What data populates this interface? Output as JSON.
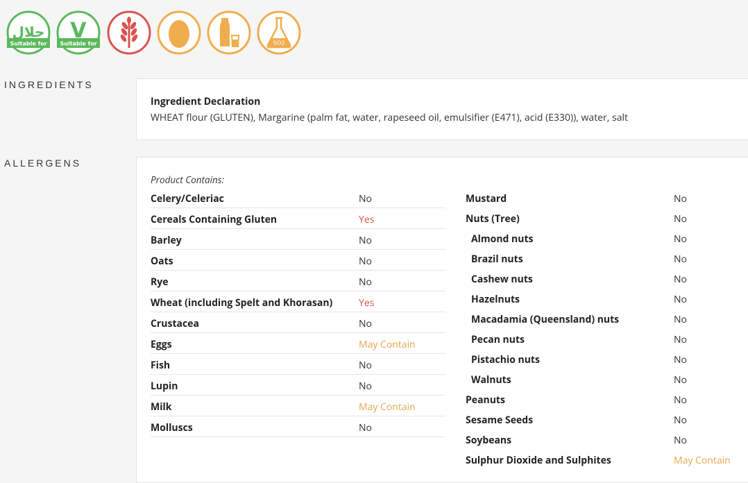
{
  "icons": [
    {
      "name": "halal-icon",
      "text": "حلال",
      "badge": "Suitable for",
      "color": "#5cb85c"
    },
    {
      "name": "vegetarian-icon",
      "text": "V",
      "badge": "Suitable for",
      "color": "#5cb85c"
    },
    {
      "name": "wheat-gluten-icon",
      "color": "#d9534f"
    },
    {
      "name": "egg-icon",
      "color": "#f0ad4e"
    },
    {
      "name": "milk-icon",
      "color": "#f0ad4e"
    },
    {
      "name": "sulphites-icon",
      "text": "SO2",
      "color": "#f0ad4e"
    }
  ],
  "sections": {
    "ingredients_label": "INGREDIENTS",
    "allergens_label": "ALLERGENS"
  },
  "ingredients": {
    "title": "Ingredient Declaration",
    "text": "WHEAT flour (GLUTEN), Margarine (palm fat, water, rapeseed oil, emulsifier (E471), acid (E330)), water, salt"
  },
  "allergens": {
    "contains_label": "Product Contains:",
    "left": [
      {
        "name": "Celery/Celeriac",
        "value": "No",
        "status": "no"
      },
      {
        "name": "Cereals Containing Gluten",
        "value": "Yes",
        "status": "yes"
      },
      {
        "name": "Barley",
        "value": "No",
        "status": "no"
      },
      {
        "name": "Oats",
        "value": "No",
        "status": "no"
      },
      {
        "name": "Rye",
        "value": "No",
        "status": "no"
      },
      {
        "name": "Wheat (including Spelt and Khorasan)",
        "value": "Yes",
        "status": "yes"
      },
      {
        "name": "Crustacea",
        "value": "No",
        "status": "no"
      },
      {
        "name": "Eggs",
        "value": "May Contain",
        "status": "may"
      },
      {
        "name": "Fish",
        "value": "No",
        "status": "no"
      },
      {
        "name": "Lupin",
        "value": "No",
        "status": "no"
      },
      {
        "name": "Milk",
        "value": "May Contain",
        "status": "may"
      },
      {
        "name": "Molluscs",
        "value": "No",
        "status": "no"
      }
    ],
    "right": [
      {
        "name": "Mustard",
        "value": "No",
        "status": "no"
      },
      {
        "name": "Nuts (Tree)",
        "value": "No",
        "status": "no"
      },
      {
        "name": "Almond nuts",
        "value": "No",
        "status": "no",
        "sub": true
      },
      {
        "name": "Brazil nuts",
        "value": "No",
        "status": "no",
        "sub": true
      },
      {
        "name": "Cashew nuts",
        "value": "No",
        "status": "no",
        "sub": true
      },
      {
        "name": "Hazelnuts",
        "value": "No",
        "status": "no",
        "sub": true
      },
      {
        "name": "Macadamia (Queensland) nuts",
        "value": "No",
        "status": "no",
        "sub": true
      },
      {
        "name": "Pecan nuts",
        "value": "No",
        "status": "no",
        "sub": true
      },
      {
        "name": "Pistachio nuts",
        "value": "No",
        "status": "no",
        "sub": true
      },
      {
        "name": "Walnuts",
        "value": "No",
        "status": "no",
        "sub": true
      },
      {
        "name": "Peanuts",
        "value": "No",
        "status": "no"
      },
      {
        "name": "Sesame Seeds",
        "value": "No",
        "status": "no"
      },
      {
        "name": "Soybeans",
        "value": "No",
        "status": "no"
      },
      {
        "name": "Sulphur Dioxide and Sulphites",
        "value": "May Contain",
        "status": "may"
      }
    ]
  }
}
